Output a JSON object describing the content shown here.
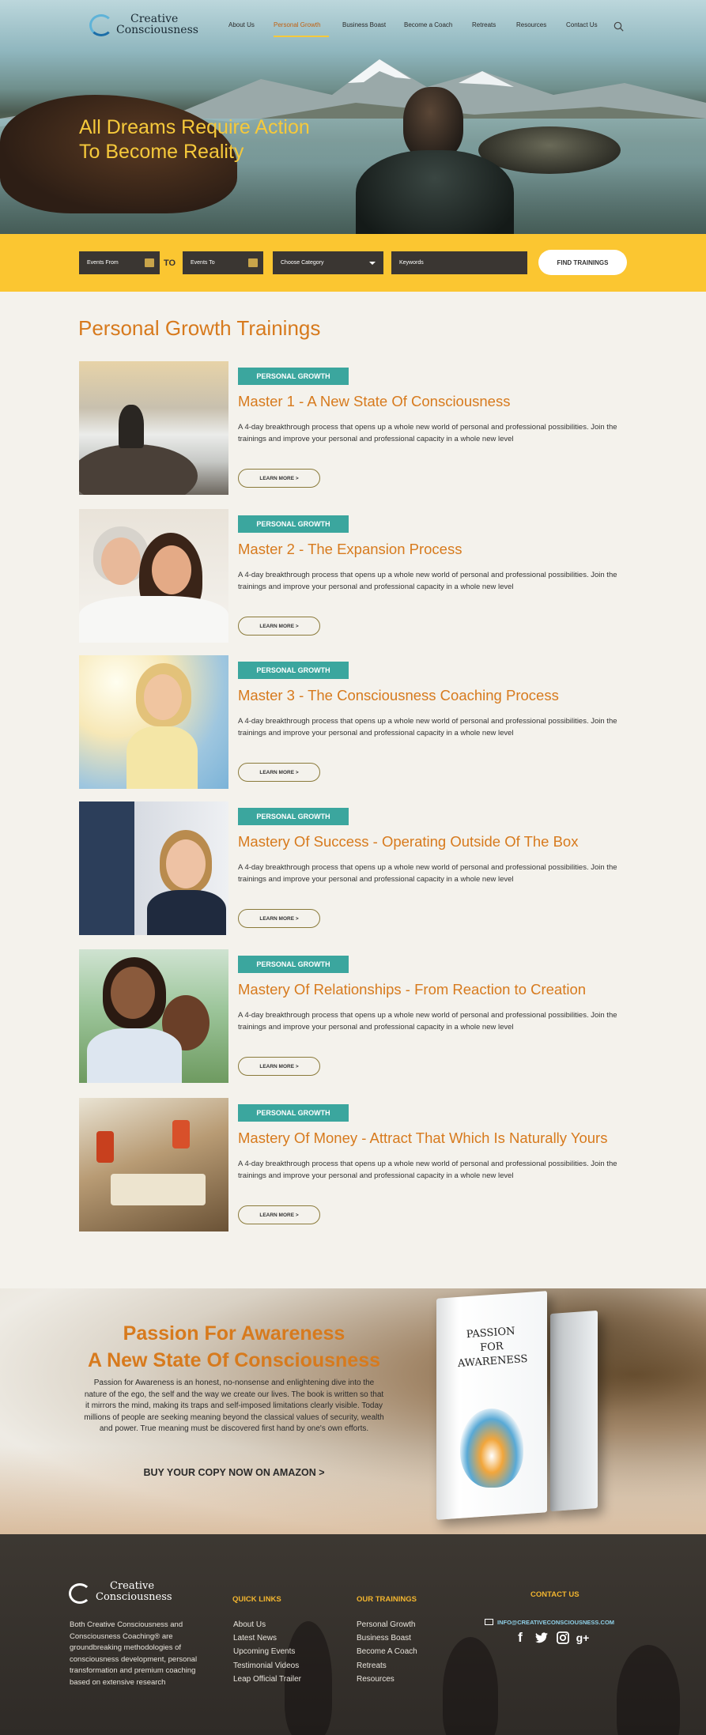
{
  "brand": {
    "line1": "Creative",
    "line2": "Consciousness"
  },
  "nav": {
    "items": [
      {
        "label": "About Us"
      },
      {
        "label": "Personal Growth"
      },
      {
        "label": "Business Boast"
      },
      {
        "label": "Become a Coach"
      },
      {
        "label": "Retreats"
      },
      {
        "label": "Resources"
      },
      {
        "label": "Contact Us"
      }
    ],
    "active": "Personal Growth",
    "search_icon": "search-icon"
  },
  "hero": {
    "title_line1": "All Dreams Require Action",
    "title_line2": "To Become Reality"
  },
  "filter": {
    "events_from": "Events From",
    "to_label": "TO",
    "events_to": "Events To",
    "category": "Choose Category",
    "keywords": "Keywords",
    "find_button": "FIND TRAININGS"
  },
  "trainings": {
    "section_title": "Personal Growth Trainings",
    "items": [
      {
        "tag": "PERSONAL GROWTH",
        "title": "Master 1 - A New State Of Consciousness",
        "description": "A 4-day breakthrough process that opens up a whole new world of personal and professional possibilities. Join the trainings and improve your personal and professional capacity in a whole new level",
        "button": "LEARN MORE >"
      },
      {
        "tag": "PERSONAL GROWTH",
        "title": "Master 2 - The Expansion Process",
        "description": "A 4-day breakthrough process that opens up a whole new world of personal and professional possibilities. Join the trainings and improve your personal and professional capacity in a whole new level",
        "button": "LEARN MORE >"
      },
      {
        "tag": "PERSONAL GROWTH",
        "title": "Master 3 - The Consciousness Coaching Process",
        "description": "A 4-day breakthrough process that opens up a whole new world of personal and professional possibilities. Join the trainings and improve your personal and professional capacity in a whole new level",
        "button": "LEARN MORE >"
      },
      {
        "tag": "PERSONAL GROWTH",
        "title": "Mastery Of Success - Operating Outside Of The Box",
        "description": "A 4-day breakthrough process that opens up a whole new world of personal and professional possibilities. Join the trainings and improve your personal and professional capacity in a whole new level",
        "button": "LEARN MORE >"
      },
      {
        "tag": "PERSONAL GROWTH",
        "title": "Mastery Of Relationships - From Reaction to Creation",
        "description": "A 4-day breakthrough process that opens up a whole new world of personal and professional possibilities. Join the trainings and improve your personal and professional capacity in a whole new level",
        "button": "LEARN MORE >"
      },
      {
        "tag": "PERSONAL GROWTH",
        "title": "Mastery Of Money - Attract That Which Is Naturally Yours",
        "description": "A 4-day breakthrough process that opens up a whole new world of personal and professional possibilities. Join the trainings and improve your personal and professional capacity in a whole new level",
        "button": "LEARN MORE >"
      }
    ]
  },
  "promo": {
    "title_line1": "Passion For Awareness",
    "title_line2": "A New State Of Consciousness",
    "text": "Passion for Awareness is an honest, no-nonsense and enlightening dive into the nature of the ego, the self and the way we create our lives. The book is written so that it mirrors the mind, making its traps and self-imposed limitations clearly visible. Today millions of people are seeking meaning beyond the classical values of security, wealth and power. True meaning must be discovered first hand by one's own efforts.",
    "cta": "BUY YOUR COPY NOW ON AMAZON  >",
    "book_title_line1": "PASSION",
    "book_title_line2": "FOR",
    "book_title_line3": "AWARENESS"
  },
  "footer": {
    "brand_line1": "Creative",
    "brand_line2": "Consciousness",
    "about": "Both Creative Consciousness and Consciousness Coaching® are groundbreaking methodologies of consciousness development, personal transformation and premium coaching based on extensive research",
    "quick_links_title": "QUICK LINKS",
    "quick_links": [
      "About Us",
      "Latest News",
      "Upcoming Events",
      "Testimonial Videos",
      "Leap Official Trailer"
    ],
    "trainings_title": "OUR TRAININGS",
    "trainings": [
      "Personal Growth",
      "Business Boast",
      "Become A Coach",
      "Retreats",
      "Resources"
    ],
    "contact_title": "CONTACT US",
    "email": "INFO@CREATIVECONSCIOUSNESS.COM",
    "social": [
      "f",
      "t",
      "ig",
      "g+"
    ]
  },
  "colors": {
    "accent_orange": "#d77a1d",
    "teal_tag": "#3ba69e",
    "yellow_bar": "#fbc631",
    "footer_bg": "#3d3832"
  }
}
